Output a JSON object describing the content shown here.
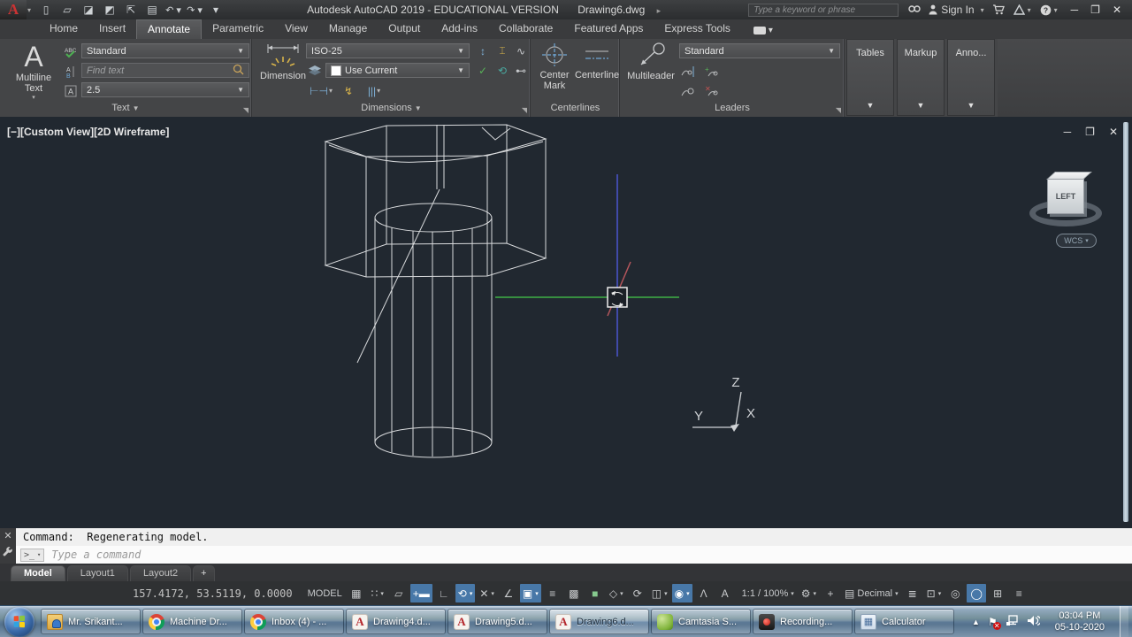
{
  "titlebar": {
    "logo_letter": "A",
    "app_title": "Autodesk AutoCAD 2019 - EDUCATIONAL VERSION",
    "doc_title": "Drawing6.dwg",
    "search_placeholder": "Type a keyword or phrase",
    "sign_in_label": "Sign In",
    "qat_icons": [
      {
        "name": "new-file-icon",
        "glyph": "▯"
      },
      {
        "name": "open-file-icon",
        "glyph": "▱"
      },
      {
        "name": "save-icon",
        "glyph": "◪"
      },
      {
        "name": "save-as-icon",
        "glyph": "◩"
      },
      {
        "name": "publish-icon",
        "glyph": "⇱"
      },
      {
        "name": "plot-icon",
        "glyph": "▤"
      },
      {
        "name": "undo-icon",
        "glyph": "↶",
        "caret": true
      },
      {
        "name": "redo-icon",
        "glyph": "↷",
        "caret": true
      },
      {
        "name": "qat-customize-icon",
        "glyph": "▾"
      }
    ]
  },
  "ribbon_tabs": [
    {
      "label": "Home"
    },
    {
      "label": "Insert"
    },
    {
      "label": "Annotate",
      "active": true
    },
    {
      "label": "Parametric"
    },
    {
      "label": "View"
    },
    {
      "label": "Manage"
    },
    {
      "label": "Output"
    },
    {
      "label": "Add-ins"
    },
    {
      "label": "Collaborate"
    },
    {
      "label": "Featured Apps"
    },
    {
      "label": "Express Tools"
    }
  ],
  "ribbon": {
    "text_panel": {
      "title": "Text",
      "big_button_label": "Multiline Text",
      "big_icon_letter": "A",
      "style_value": "Standard",
      "find_placeholder": "Find text",
      "height_value": "2.5"
    },
    "dimensions_panel": {
      "title": "Dimensions",
      "big_button_label": "Dimension",
      "style_value": "ISO-25",
      "layer_value": "Use Current"
    },
    "centerlines_panel": {
      "title": "Centerlines",
      "center_mark_label": "Center Mark",
      "centerline_label": "Centerline"
    },
    "leaders_panel": {
      "title": "Leaders",
      "big_button_label": "Multileader",
      "style_value": "Standard"
    },
    "collapsed_panels": [
      {
        "label": "Tables"
      },
      {
        "label": "Markup"
      },
      {
        "label": "Anno..."
      }
    ]
  },
  "viewport": {
    "controls": [
      "[−]",
      "[Custom View]",
      "[2D Wireframe]"
    ],
    "viewcube_face": "LEFT",
    "wcs_label": "WCS",
    "ucs": {
      "z": "Z",
      "y": "Y",
      "x": "X"
    }
  },
  "command": {
    "history_line": "Command:  Regenerating model.",
    "prompt_placeholder": "Type a command",
    "prompt_chip": ">_"
  },
  "layout_tabs": [
    {
      "label": "Model",
      "active": true
    },
    {
      "label": "Layout1"
    },
    {
      "label": "Layout2"
    },
    {
      "label": "+",
      "add": true
    }
  ],
  "statusbar": {
    "coords": "157.4172, 53.5119, 0.0000",
    "items": [
      {
        "name": "model-space-toggle",
        "label": "MODEL"
      },
      {
        "name": "grid-display",
        "glyph": "▦"
      },
      {
        "name": "snap-mode",
        "glyph": "∷",
        "caret": true
      },
      {
        "name": "infer-constraints",
        "glyph": "▱"
      },
      {
        "name": "dynamic-input",
        "glyph": "+▬",
        "on": true
      },
      {
        "name": "ortho-mode",
        "glyph": "∟"
      },
      {
        "name": "polar-tracking",
        "glyph": "⟲",
        "on": true,
        "caret": true
      },
      {
        "name": "isometric-drafting",
        "glyph": "✕",
        "caret": true
      },
      {
        "name": "object-snap-tracking",
        "glyph": "∠"
      },
      {
        "name": "object-snap-2d",
        "glyph": "▣",
        "on": true,
        "caret": true
      },
      {
        "name": "lineweight",
        "glyph": "≡"
      },
      {
        "name": "transparency",
        "glyph": "▩"
      },
      {
        "name": "selection-cycling",
        "glyph": "■",
        "tint": "#86c98e"
      },
      {
        "name": "object-snap-3d",
        "glyph": "◇",
        "caret": true
      },
      {
        "name": "dynamic-ucs",
        "glyph": "⟳"
      },
      {
        "name": "ucs-icon-display",
        "glyph": "◫",
        "caret": true
      },
      {
        "name": "gizmo",
        "glyph": "◉",
        "on": true,
        "caret": true
      },
      {
        "name": "annotation-visibility",
        "glyph": "Λ"
      },
      {
        "name": "autoscale-annotation",
        "glyph": "A"
      },
      {
        "name": "annotation-scale",
        "label": "1:1 / 100%",
        "caret": true
      },
      {
        "name": "workspace-switching",
        "glyph": "⚙",
        "caret": true
      },
      {
        "name": "annotation-monitor",
        "glyph": "+"
      },
      {
        "name": "units",
        "glyph": "▤",
        "label": "Decimal",
        "caret": true
      },
      {
        "name": "quick-properties",
        "glyph": "≣"
      },
      {
        "name": "ui-lock",
        "glyph": "⊡",
        "caret": true
      },
      {
        "name": "isolate-objects",
        "glyph": "◎"
      },
      {
        "name": "graphics-performance",
        "glyph": "◯",
        "on": true
      },
      {
        "name": "clean-screen",
        "glyph": "⊞"
      },
      {
        "name": "customization-menu",
        "glyph": "≡"
      }
    ]
  },
  "taskbar": {
    "buttons": [
      {
        "label": "Mr. Srikant...",
        "icon": "folder-user"
      },
      {
        "label": "Machine Dr...",
        "icon": "chrome"
      },
      {
        "label": "Inbox (4) - ...",
        "icon": "chrome"
      },
      {
        "label": "Drawing4.d...",
        "icon": "autocad"
      },
      {
        "label": "Drawing5.d...",
        "icon": "autocad"
      },
      {
        "label": "Drawing6.d...",
        "icon": "autocad",
        "active": true
      },
      {
        "label": "Camtasia S...",
        "icon": "camtasia"
      },
      {
        "label": "Recording...",
        "icon": "recorder"
      },
      {
        "label": "Calculator",
        "icon": "calculator"
      }
    ],
    "tray": {
      "time": "03:04 PM",
      "date": "05-10-2020"
    }
  },
  "colors": {
    "status_toggle_on": "#4878a8",
    "crosshair_green": "#3faf46",
    "crosshair_blue": "#4b55cf",
    "crosshair_red": "#b5565c",
    "canvas_background": "#212830"
  }
}
